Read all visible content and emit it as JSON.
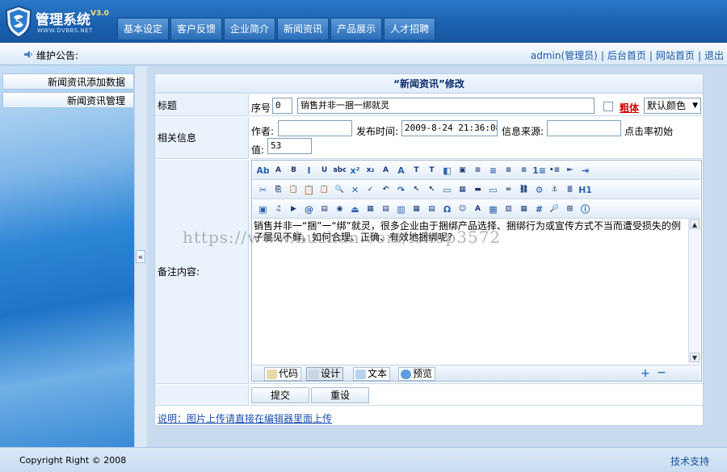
{
  "app": {
    "title": "管理系统",
    "version": "V3.0",
    "subtitle": "WWW.DVBBS.NET"
  },
  "topnav": [
    "基本设定",
    "客户反馈",
    "企业简介",
    "新闻资讯",
    "产品展示",
    "人才招聘"
  ],
  "notice": {
    "label": "维护公告:"
  },
  "user_links": {
    "admin": "admin(管理员)",
    "backend_home": "后台首页",
    "site_home": "网站首页",
    "logout": "退出",
    "separator": "|"
  },
  "sidebar": {
    "items": [
      "新闻资讯添加数据",
      "新闻资讯管理"
    ]
  },
  "collapse": {
    "glyph": "«"
  },
  "form": {
    "title": "“新闻资讯”修改",
    "row_title_label": "标题",
    "seq_label": "序号",
    "seq_value": "0",
    "title_value": "销售并非一捆一绑就灵",
    "bold_label": "粗体",
    "color_select_value": "默认颜色",
    "related_label": "相关信息",
    "author_label": "作者:",
    "author_value": "",
    "publish_time_label": "发布时间:",
    "publish_time_value": "2009-8-24 21:36:08",
    "source_label": "信息来源:",
    "source_value": "",
    "clicks_label": "点击率初始",
    "clicks_label2": "值:",
    "clicks_value": "53",
    "notes_label": "备注内容:"
  },
  "editor": {
    "content": "销售并非一“捆”一“绑”就灵，很多企业由于捆绑产品选择、捆绑行为或宣传方式不当而遭受损失的例子屡见不鲜。如何合理、正确、有效地捆绑呢?",
    "tabs": [
      "代码",
      "设计",
      "文本",
      "预览"
    ],
    "active_tab": "设计",
    "toolbar_row1": [
      "Ab",
      "A",
      "B",
      "I",
      "U",
      "abc",
      "x²",
      "x₂",
      "A",
      "A",
      "T",
      "T",
      "◧",
      "▣",
      "≡",
      "≡",
      "≡",
      "≡",
      "1≡",
      "•≡",
      "⇤",
      "⇥"
    ],
    "toolbar_row2": [
      "✂",
      "⎘",
      "📋",
      "📋",
      "📋",
      "🔍",
      "✕",
      "✓",
      "↶",
      "↷",
      "↖",
      "↖",
      "▭",
      "▦",
      "▬",
      "▭",
      "∞",
      "⛓",
      "⚙",
      "⚓",
      "≣",
      "H1"
    ],
    "toolbar_row3": [
      "▣",
      "♫",
      "▶",
      "@",
      "▤",
      "◉",
      "⏏",
      "▦",
      "▤",
      "▥",
      "▦",
      "▤",
      "Ω",
      "☺",
      "A",
      "▦",
      "▥",
      "▦",
      "#",
      "🔎",
      "⊞",
      "ⓘ"
    ],
    "resize_plus": "+",
    "resize_minus": "−"
  },
  "buttons": {
    "submit": "提交",
    "reset": "重设"
  },
  "note": "说明：图片上传请直接在编辑器里面上传",
  "footer": {
    "copyright": "Copyright Right © 2008",
    "tech_support": "技术支持"
  },
  "watermark": "https://www.huzhan.com/ishop3572",
  "colors": {
    "topbar": "#1a5fae",
    "link": "#1a5aa8",
    "bold_red": "#d40000",
    "label_bg": "#eaf3fc"
  }
}
